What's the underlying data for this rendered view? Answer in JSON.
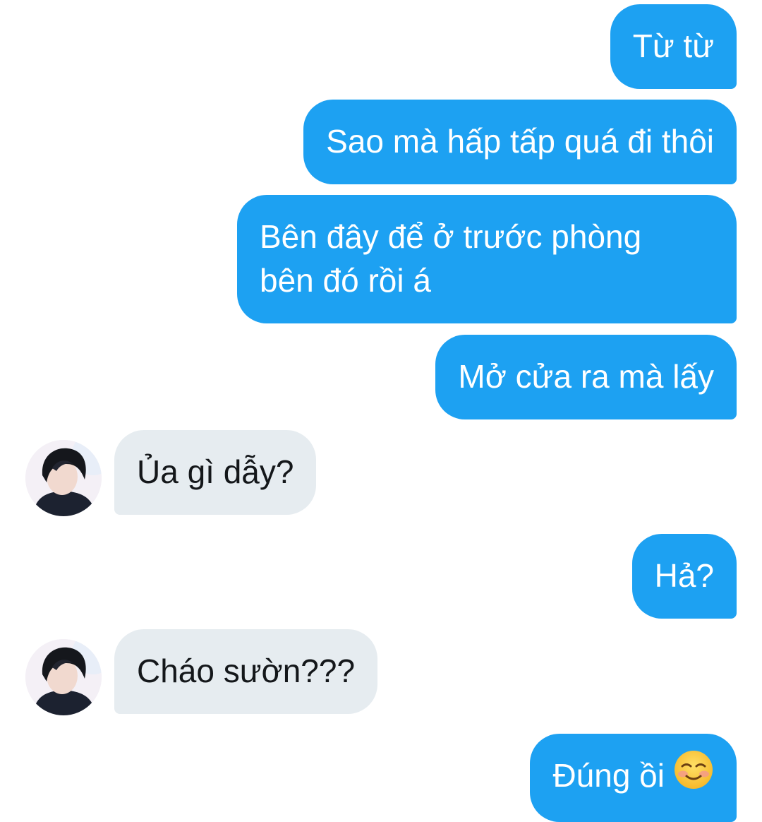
{
  "thread": {
    "messages": [
      {
        "id": "m1",
        "side": "out",
        "text": "Từ từ"
      },
      {
        "id": "m2",
        "side": "out",
        "text": "Sao mà hấp tấp quá đi thôi"
      },
      {
        "id": "m3",
        "side": "out",
        "lines": [
          "Bên đây để ở trước phòng",
          "bên đó rồi á"
        ]
      },
      {
        "id": "m4",
        "side": "out",
        "text": "Mở cửa ra mà lấy"
      },
      {
        "id": "m5",
        "side": "in",
        "text": "Ủa gì dẫy?"
      },
      {
        "id": "m6",
        "side": "out",
        "text": "Hả?"
      },
      {
        "id": "m7",
        "side": "in",
        "text": "Cháo sườn???"
      },
      {
        "id": "m8",
        "side": "out",
        "text": "Đúng ồi",
        "emoji": "smiling-blush-emoji"
      }
    ]
  },
  "colors": {
    "outgoing_bubble": "#1da1f2",
    "incoming_bubble": "#e6ecf0",
    "outgoing_text": "#ffffff",
    "incoming_text": "#14171a",
    "background": "#ffffff"
  }
}
